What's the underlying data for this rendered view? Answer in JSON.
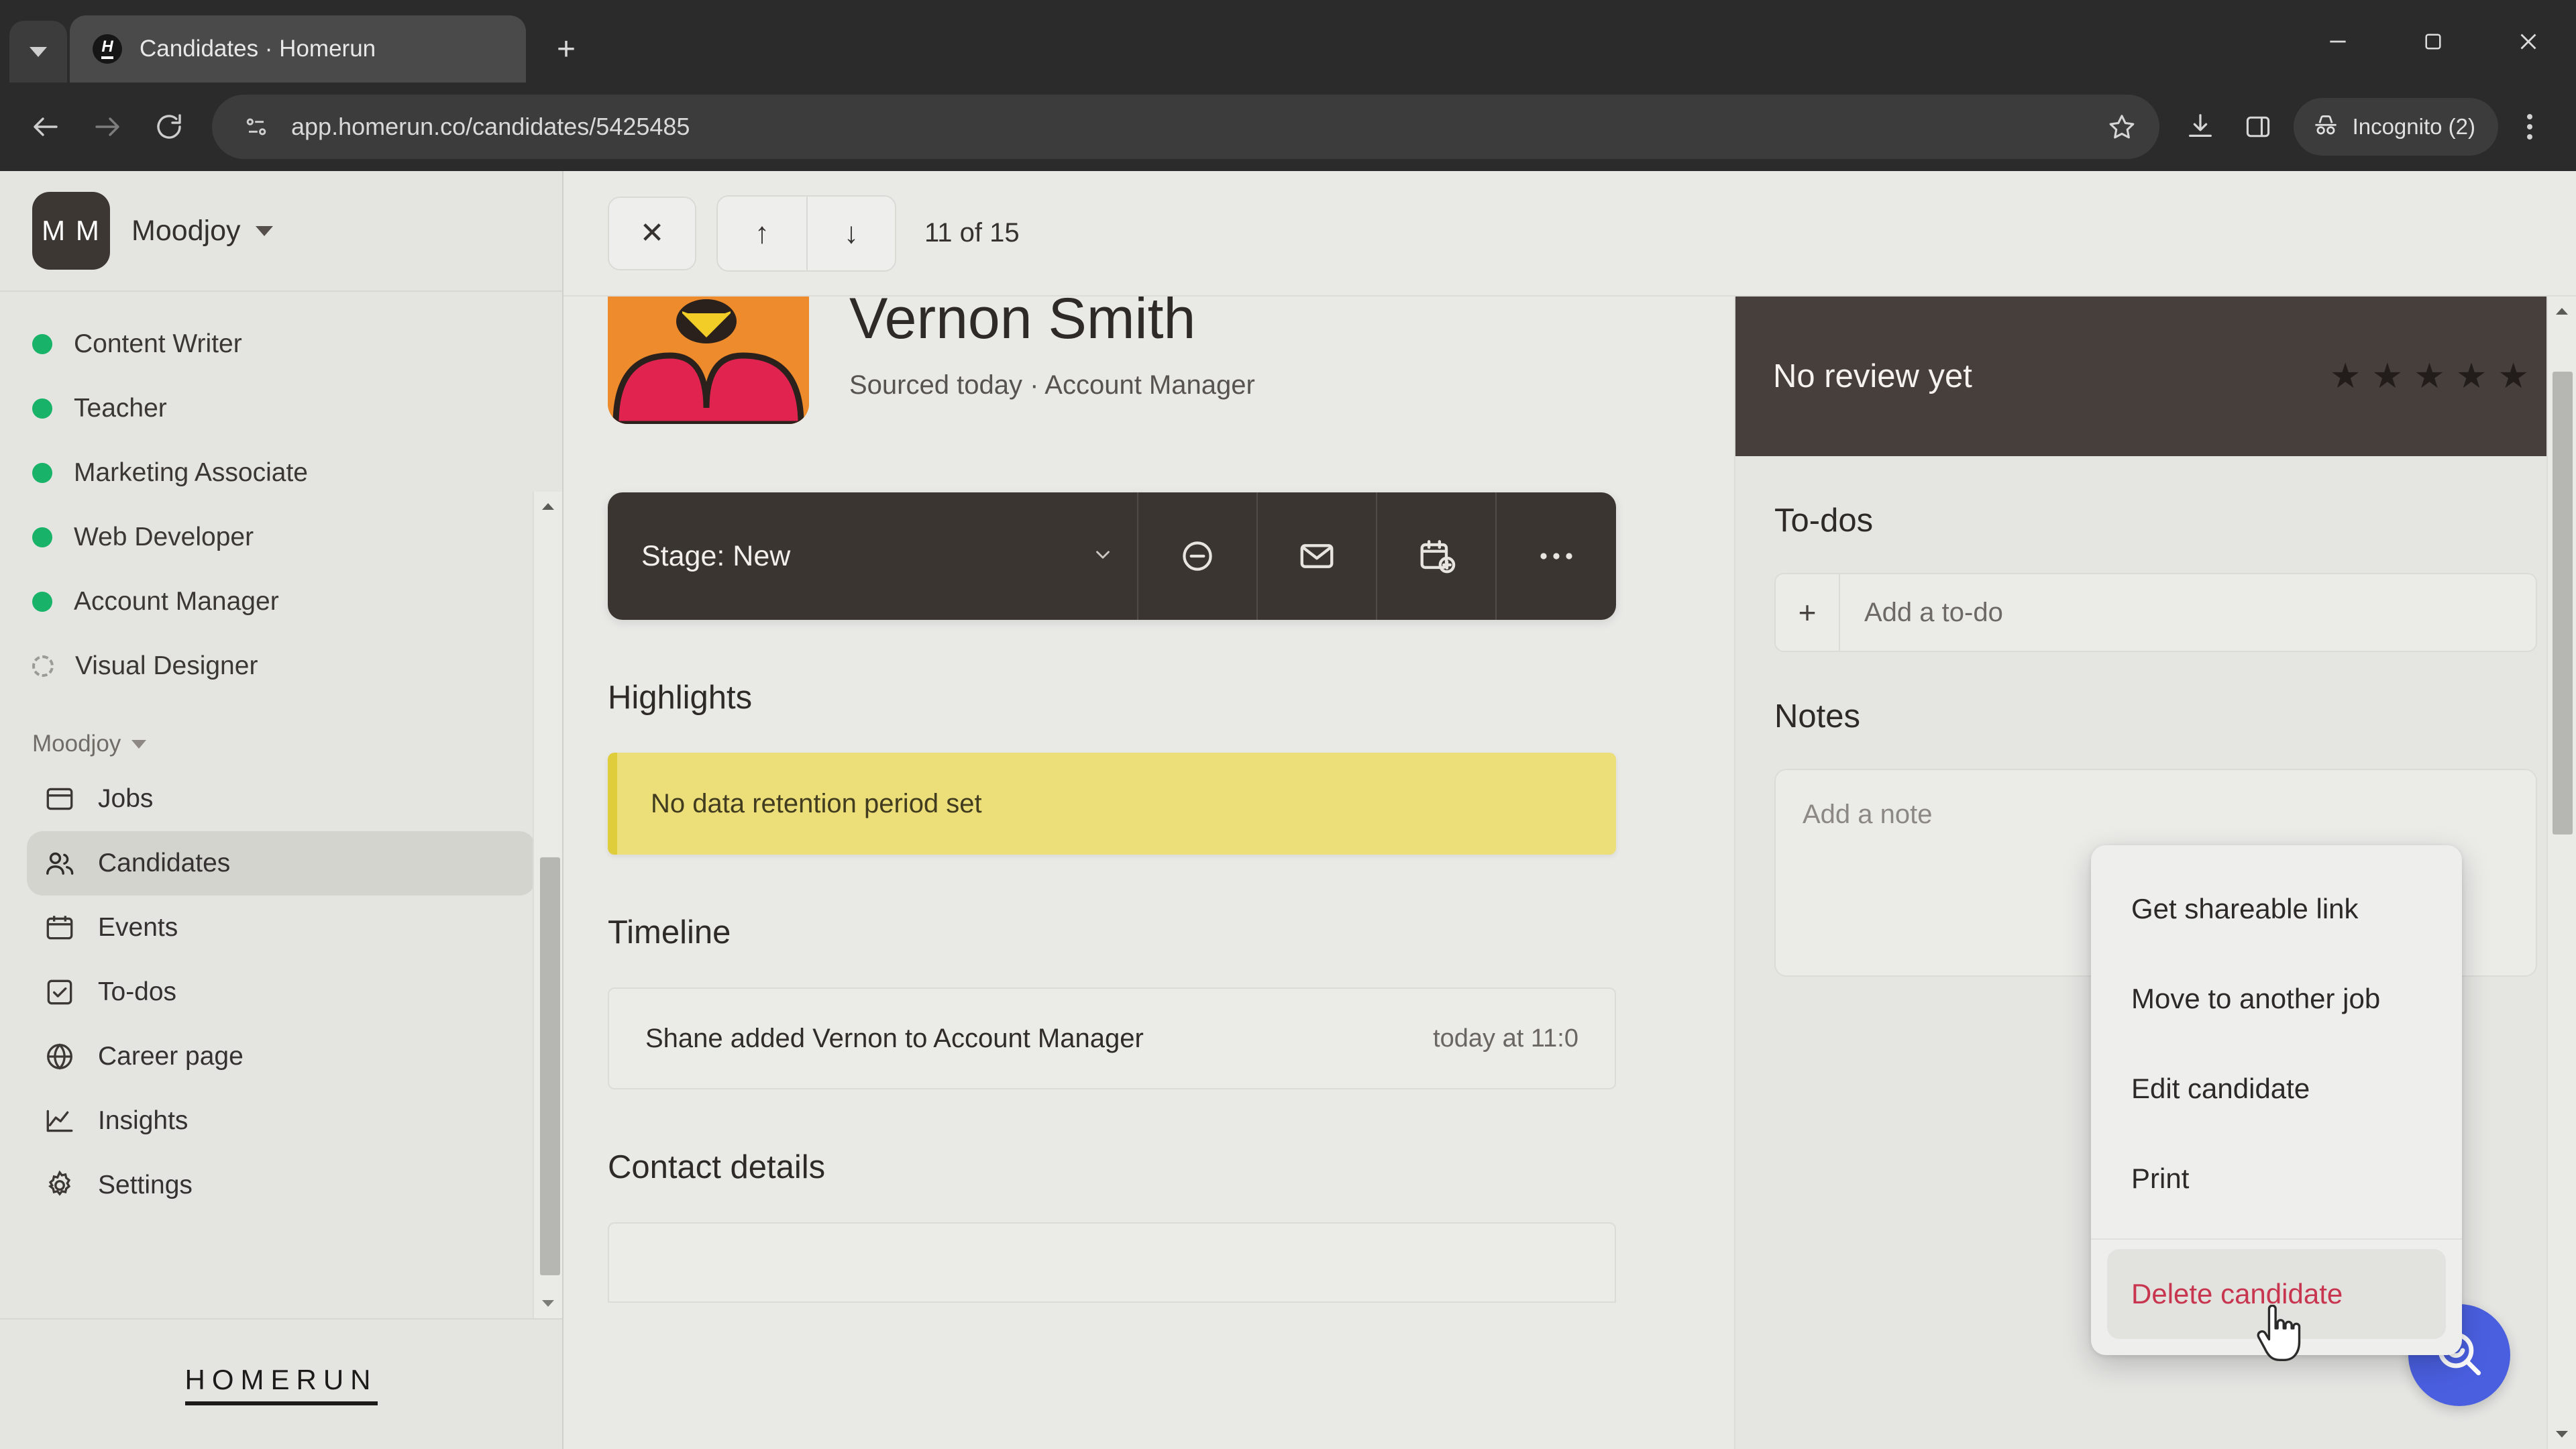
{
  "browser": {
    "tab": {
      "title": "Candidates · Homerun",
      "favicon_letter": "H"
    },
    "new_tab_label": "+",
    "close_tab_label": "✕",
    "address": "app.homerun.co/candidates/5425485",
    "profile_label": "Incognito (2)",
    "icons": {
      "tab_list": "chevron-down-icon",
      "back": "back-arrow-icon",
      "forward": "forward-arrow-icon",
      "reload": "reload-icon",
      "site_info": "page-info-icon",
      "bookmark": "star-icon",
      "downloads": "download-icon",
      "side_panel": "side-panel-icon",
      "incognito": "incognito-icon",
      "menu": "three-dot-menu-icon",
      "minimize": "minimize-icon",
      "maximize": "maximize-icon",
      "close_window": "close-window-icon"
    }
  },
  "sidebar": {
    "org": {
      "initials": "M M",
      "name": "Moodjoy"
    },
    "jobs": [
      {
        "label": "Content Writer",
        "status": "open"
      },
      {
        "label": "Teacher",
        "status": "open"
      },
      {
        "label": "Marketing Associate",
        "status": "open"
      },
      {
        "label": "Web Developer",
        "status": "open"
      },
      {
        "label": "Account Manager",
        "status": "open"
      },
      {
        "label": "Visual Designer",
        "status": "draft"
      }
    ],
    "workspace_label": "Moodjoy",
    "nav": [
      {
        "label": "Jobs",
        "icon": "jobs-icon",
        "active": false
      },
      {
        "label": "Candidates",
        "icon": "candidates-icon",
        "active": true
      },
      {
        "label": "Events",
        "icon": "calendar-icon",
        "active": false
      },
      {
        "label": "To-dos",
        "icon": "checkbox-icon",
        "active": false
      },
      {
        "label": "Career page",
        "icon": "globe-icon",
        "active": false
      },
      {
        "label": "Insights",
        "icon": "chart-icon",
        "active": false
      },
      {
        "label": "Settings",
        "icon": "gear-icon",
        "active": false
      }
    ],
    "footer_logo": "HOMERUN"
  },
  "main": {
    "toolbar": {
      "close_label": "✕",
      "prev_label": "↑",
      "next_label": "↓",
      "counter": "11 of 15"
    },
    "candidate": {
      "name": "Vernon Smith",
      "subtitle": "Sourced today · Account Manager"
    },
    "stage": {
      "label": "Stage: New",
      "actions": [
        "reject-icon",
        "email-icon",
        "schedule-icon",
        "more-icon"
      ]
    },
    "highlights": {
      "title": "Highlights",
      "items": [
        "No data retention period set"
      ]
    },
    "timeline": {
      "title": "Timeline",
      "entries": [
        {
          "text": "Shane added Vernon to Account Manager",
          "time": "today at 11:0"
        }
      ]
    },
    "contact": {
      "title": "Contact details"
    }
  },
  "right_panel": {
    "review": {
      "text": "No review yet",
      "stars": 5,
      "filled": 0
    },
    "todos": {
      "title": "To-dos",
      "add_placeholder": "Add a to-do",
      "add_icon": "plus-icon"
    },
    "notes": {
      "title": "Notes",
      "placeholder": "Add a note"
    }
  },
  "context_menu": {
    "items": [
      {
        "label": "Get shareable link",
        "danger": false
      },
      {
        "label": "Move to another job",
        "danger": false
      },
      {
        "label": "Edit candidate",
        "danger": false
      },
      {
        "label": "Print",
        "danger": false
      }
    ],
    "destructive": {
      "label": "Delete candidate",
      "danger": true,
      "hovered": true
    }
  },
  "help_button": {
    "icon": "search-smiley-icon",
    "color": "#4a5fe0"
  },
  "colors": {
    "accent_green": "#18b268",
    "warning_yellow": "#ecdf79",
    "danger_red": "#c8354f",
    "dark_panel": "#3a3531",
    "review_banner": "#473f3b"
  }
}
